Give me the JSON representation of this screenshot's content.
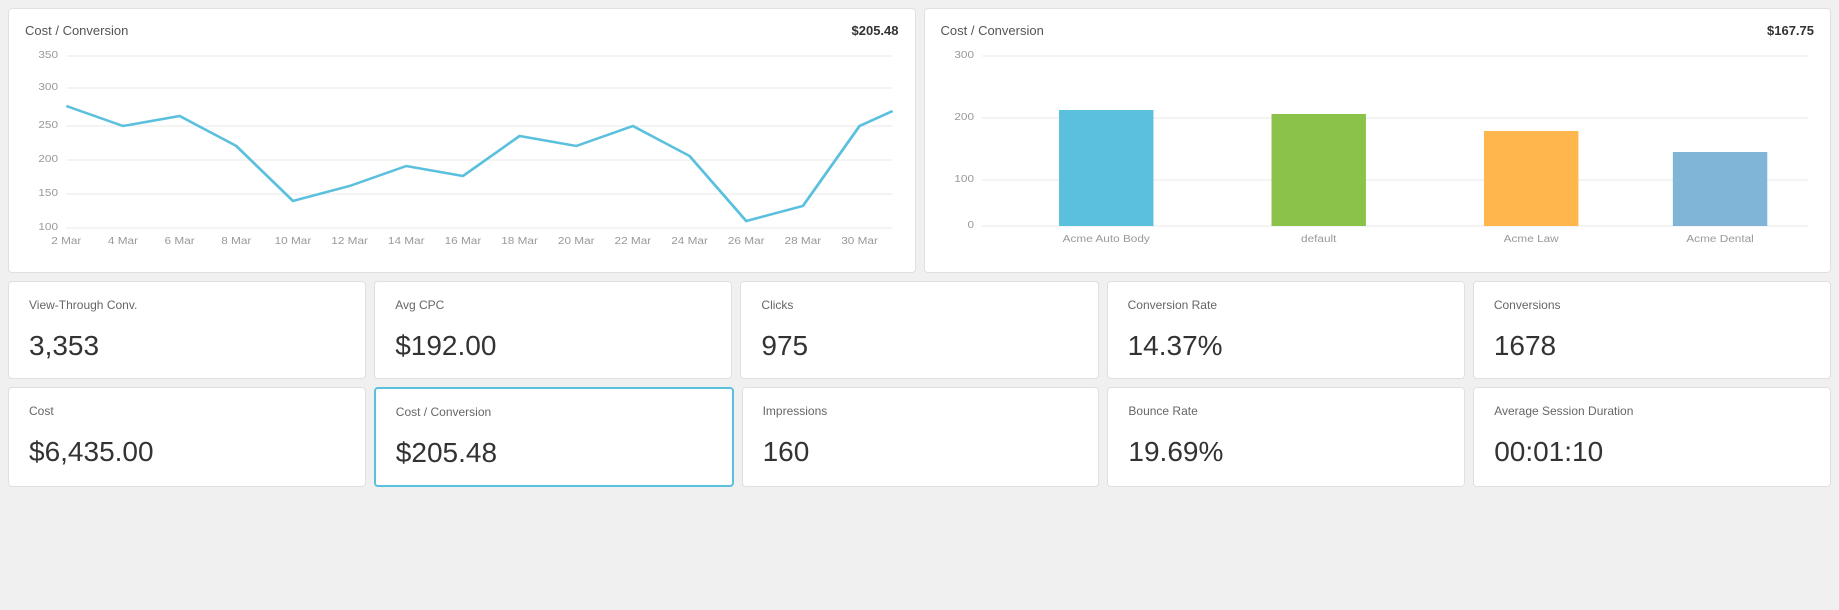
{
  "leftChart": {
    "title": "Cost / Conversion",
    "value": "$205.48",
    "yAxis": [
      "350",
      "300",
      "250",
      "200",
      "150",
      "100"
    ],
    "xAxis": [
      "2 Mar",
      "4 Mar",
      "6 Mar",
      "8 Mar",
      "10 Mar",
      "12 Mar",
      "14 Mar",
      "16 Mar",
      "18 Mar",
      "20 Mar",
      "22 Mar",
      "24 Mar",
      "26 Mar",
      "28 Mar",
      "30 Mar"
    ]
  },
  "rightChart": {
    "title": "Cost / Conversion",
    "value": "$167.75",
    "yAxis": [
      "300",
      "200",
      "100",
      "0"
    ],
    "bars": [
      {
        "label": "Acme Auto Body",
        "value": 205,
        "color": "#5bc0de"
      },
      {
        "label": "default",
        "value": 198,
        "color": "#8bc34a"
      },
      {
        "label": "Acme Law",
        "value": 168,
        "color": "#ffb74d"
      },
      {
        "label": "Acme Dental",
        "value": 130,
        "color": "#81b5d8"
      }
    ]
  },
  "topMetrics": [
    {
      "label": "View-Through Conv.",
      "value": "3,353"
    },
    {
      "label": "Avg CPC",
      "value": "$192.00"
    },
    {
      "label": "Clicks",
      "value": "975"
    },
    {
      "label": "Conversion Rate",
      "value": "14.37%"
    },
    {
      "label": "Conversions",
      "value": "1678"
    }
  ],
  "bottomMetrics": [
    {
      "label": "Cost",
      "value": "$6,435.00",
      "selected": false
    },
    {
      "label": "Cost / Conversion",
      "value": "$205.48",
      "selected": true
    },
    {
      "label": "Impressions",
      "value": "160",
      "selected": false
    },
    {
      "label": "Bounce Rate",
      "value": "19.69%",
      "selected": false
    },
    {
      "label": "Average Session Duration",
      "value": "00:01:10",
      "selected": false
    }
  ]
}
